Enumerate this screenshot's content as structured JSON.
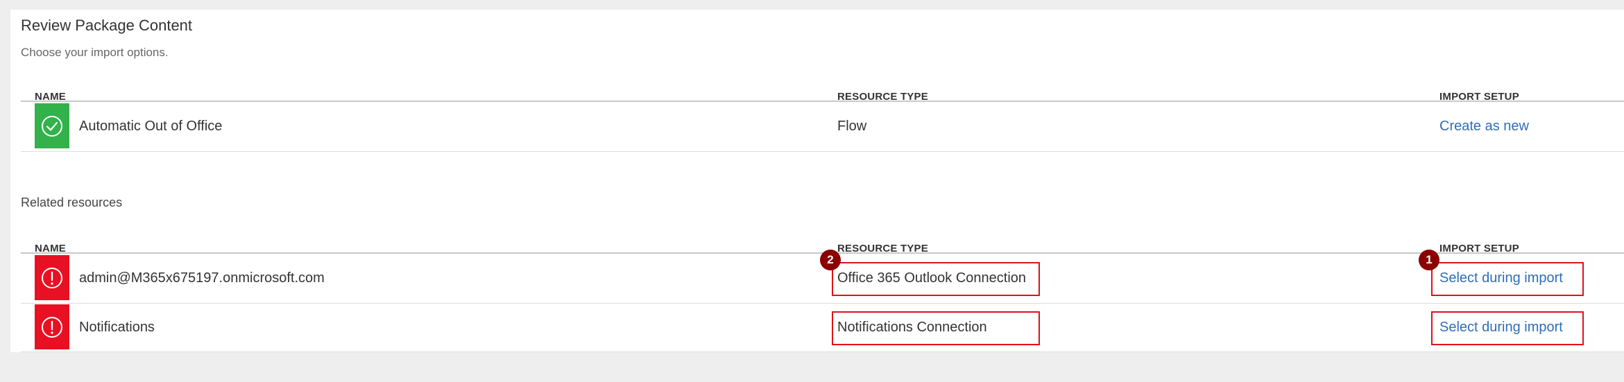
{
  "page": {
    "title": "Review Package Content",
    "subtitle": "Choose your import options."
  },
  "columns": {
    "name": "NAME",
    "resource_type": "RESOURCE TYPE",
    "import_setup": "IMPORT SETUP"
  },
  "main_table": {
    "rows": [
      {
        "status": "success",
        "status_icon": "check-circle-icon",
        "name": "Automatic Out of Office",
        "resource_type": "Flow",
        "import_setup": "Create as new"
      }
    ]
  },
  "related": {
    "label": "Related resources",
    "rows": [
      {
        "status": "error",
        "status_icon": "error-circle-icon",
        "name": "admin@M365x675197.onmicrosoft.com",
        "resource_type": "Office 365 Outlook Connection",
        "import_setup": "Select during import"
      },
      {
        "status": "error",
        "status_icon": "error-circle-icon",
        "name": "Notifications",
        "resource_type": "Notifications Connection",
        "import_setup": "Select during import"
      }
    ]
  },
  "annotations": {
    "badge_1": "1",
    "badge_2": "2"
  },
  "colors": {
    "success": "#33b14a",
    "error": "#e81123",
    "link": "#2f6db5",
    "highlight": "#e0101a",
    "badge": "#8b0000"
  }
}
